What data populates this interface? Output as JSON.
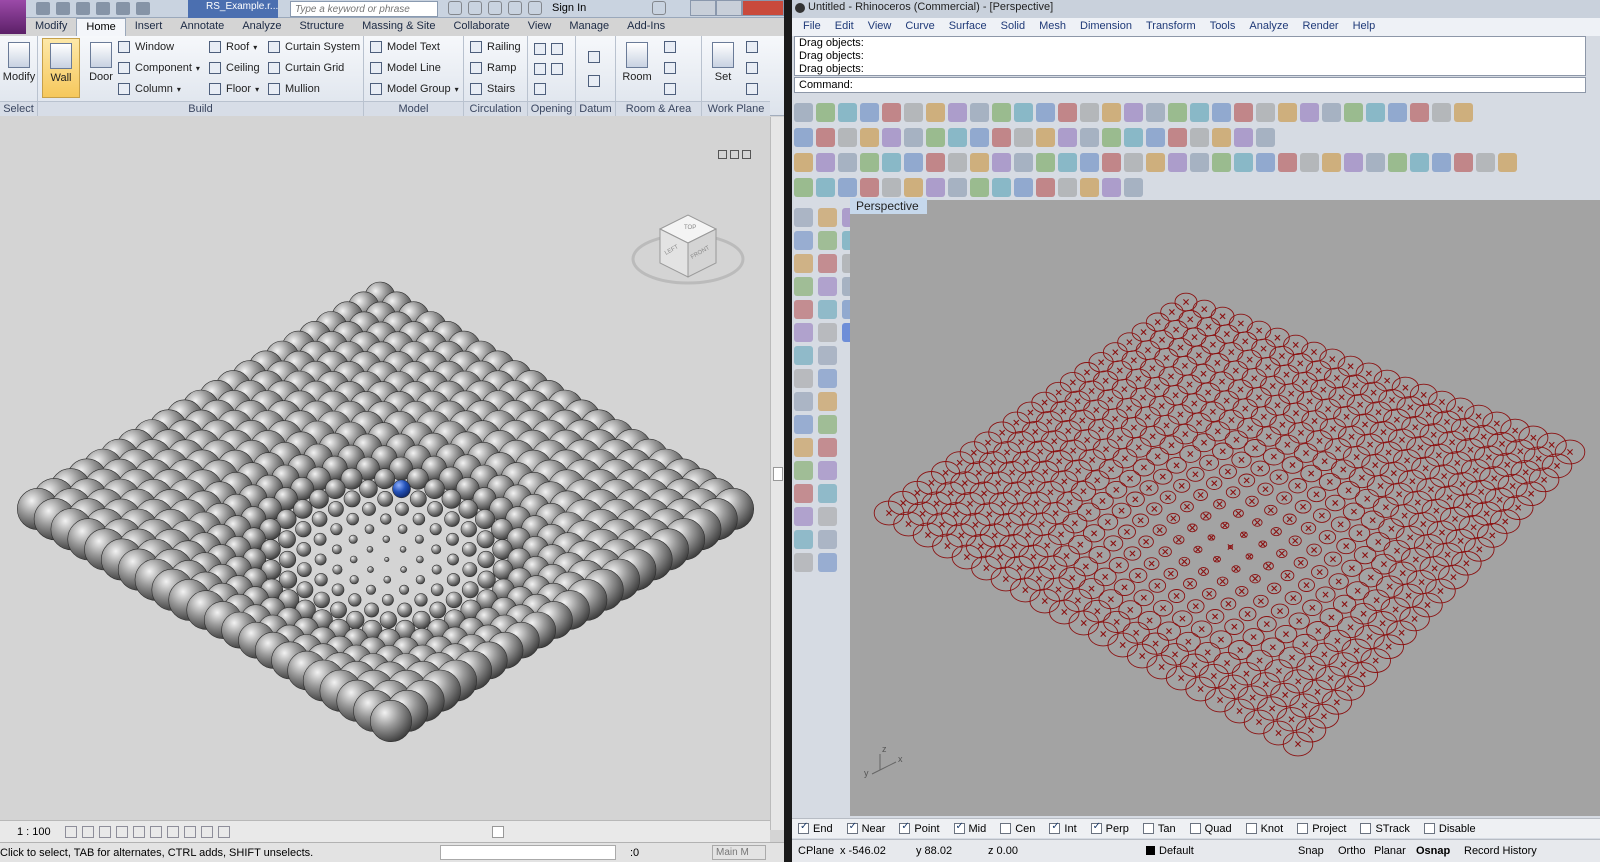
{
  "revit": {
    "doc_tab": "RS_Example.r...",
    "search_placeholder": "Type a keyword or phrase",
    "sign_in": "Sign In",
    "tabs": [
      "Modify",
      "Home",
      "Insert",
      "Annotate",
      "Analyze",
      "Structure",
      "Massing & Site",
      "Collaborate",
      "View",
      "Manage",
      "Add-Ins"
    ],
    "active_tab": "Home",
    "select": {
      "button": "Modify",
      "panel": "Select"
    },
    "build": {
      "panel": "Build",
      "wall": "Wall",
      "door": "Door",
      "window": "Window",
      "component": "Component",
      "column": "Column",
      "roof": "Roof",
      "ceiling": "Ceiling",
      "floor": "Floor",
      "curtain_system": "Curtain System",
      "curtain_grid": "Curtain Grid",
      "mullion": "Mullion"
    },
    "model": {
      "panel": "Model",
      "model_text": "Model Text",
      "model_line": "Model Line",
      "model_group": "Model Group"
    },
    "circulation": {
      "panel": "Circulation",
      "railing": "Railing",
      "ramp": "Ramp",
      "stairs": "Stairs"
    },
    "opening": {
      "panel": "Opening"
    },
    "datum": {
      "panel": "Datum"
    },
    "room_area": {
      "panel": "Room & Area",
      "room": "Room"
    },
    "work_plane": {
      "panel": "Work Plane",
      "set": "Set"
    },
    "viewcube": {
      "top": "TOP",
      "left": "LEFT",
      "front": "FRONT"
    },
    "scale": "1 : 100",
    "status_message": "Click to select, TAB for alternates, CTRL adds, SHIFT unselects.",
    "status_zero": ":0",
    "main_model": "Main M"
  },
  "rhino": {
    "title": "Untitled - Rhinoceros (Commercial) - [Perspective]",
    "menus": [
      "File",
      "Edit",
      "View",
      "Curve",
      "Surface",
      "Solid",
      "Mesh",
      "Dimension",
      "Transform",
      "Tools",
      "Analyze",
      "Render",
      "Help"
    ],
    "command_history": [
      "Drag objects:",
      "Drag objects:",
      "Drag objects:"
    ],
    "command_prompt": "Command:",
    "viewport_title": "Perspective",
    "axis": {
      "x": "x",
      "y": "y",
      "z": "z"
    },
    "osnaps": [
      {
        "label": "End",
        "on": true
      },
      {
        "label": "Near",
        "on": true
      },
      {
        "label": "Point",
        "on": true
      },
      {
        "label": "Mid",
        "on": true
      },
      {
        "label": "Cen",
        "on": false
      },
      {
        "label": "Int",
        "on": true
      },
      {
        "label": "Perp",
        "on": true
      },
      {
        "label": "Tan",
        "on": false
      },
      {
        "label": "Quad",
        "on": false
      },
      {
        "label": "Knot",
        "on": false
      },
      {
        "label": "Project",
        "on": false
      },
      {
        "label": "STrack",
        "on": false
      },
      {
        "label": "Disable",
        "on": false
      }
    ],
    "status": {
      "cplane": "CPlane",
      "x": "x -546.02",
      "y": "y 88.02",
      "z": "z 0.00",
      "layer": "Default",
      "snap": "Snap",
      "ortho": "Ortho",
      "planar": "Planar",
      "osnap": "Osnap",
      "record_history": "Record History"
    }
  },
  "colors": {
    "revit_view_bg": "#d4d4d4",
    "rhino_view_bg": "#a3a3a3",
    "rhino_curve": "#8b1212",
    "selected_sphere": "#1a4fb8"
  }
}
